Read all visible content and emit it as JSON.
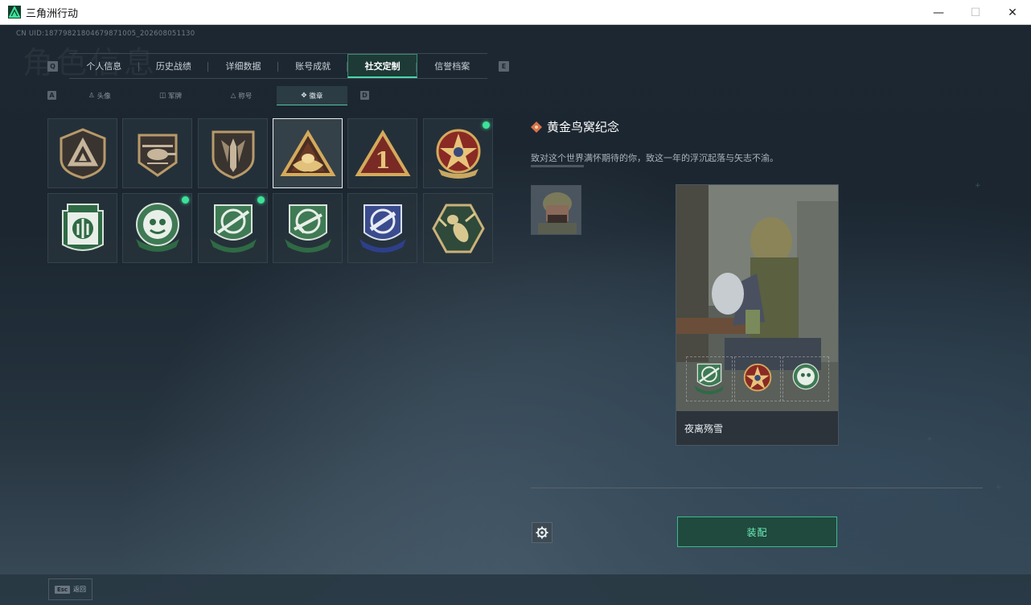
{
  "window": {
    "title": "三角洲行动",
    "minimize_glyph": "—",
    "maximize_glyph": "☐",
    "close_glyph": "✕"
  },
  "header": {
    "uid": "CN UID:18779821804679871005_202608051130",
    "bg_title": "角色信息"
  },
  "tabs": {
    "prev_key": "Q",
    "next_key": "E",
    "items": [
      {
        "label": "个人信息",
        "active": false
      },
      {
        "label": "历史战绩",
        "active": false
      },
      {
        "label": "详细数据",
        "active": false
      },
      {
        "label": "账号成就",
        "active": false
      },
      {
        "label": "社交定制",
        "active": true
      },
      {
        "label": "信誉档案",
        "active": false
      }
    ]
  },
  "subtabs": {
    "prev_key": "A",
    "next_key": "D",
    "items": [
      {
        "label": "头像",
        "icon": "person-icon",
        "glyph": "♙",
        "active": false
      },
      {
        "label": "军牌",
        "icon": "dogtag-icon",
        "glyph": "◫",
        "active": false
      },
      {
        "label": "称号",
        "icon": "triangle-icon",
        "glyph": "△",
        "active": false
      },
      {
        "label": "徽章",
        "icon": "badge-icon",
        "glyph": "✥",
        "active": true
      }
    ]
  },
  "badges": [
    {
      "icon": "delta-shield-badge-icon",
      "new": false,
      "selected": false
    },
    {
      "icon": "helicopter-badge-icon",
      "new": false,
      "selected": false
    },
    {
      "icon": "dagger-shield-badge-icon",
      "new": false,
      "selected": false
    },
    {
      "icon": "golden-nest-badge-icon",
      "new": false,
      "selected": true
    },
    {
      "icon": "number-one-badge-icon",
      "new": false,
      "selected": false
    },
    {
      "icon": "star-medal-badge-icon",
      "new": true,
      "selected": false
    },
    {
      "icon": "green-emblem-badge-icon",
      "new": false,
      "selected": false
    },
    {
      "icon": "green-beast-badge-icon",
      "new": true,
      "selected": false
    },
    {
      "icon": "green-crosshair-badge-icon",
      "new": true,
      "selected": false
    },
    {
      "icon": "green-rifle-badge-icon",
      "new": false,
      "selected": false
    },
    {
      "icon": "blue-knife-badge-icon",
      "new": false,
      "selected": false
    },
    {
      "icon": "wasp-hexagon-badge-icon",
      "new": false,
      "selected": false
    }
  ],
  "detail": {
    "title": "黄金鸟窝纪念",
    "description": "致对这个世界满怀期待的你，致这一年的浮沉起落与矢志不渝。",
    "card_name": "夜离殇雪",
    "equip_label": "装配"
  },
  "footer": {
    "esc_key": "Esc",
    "esc_label": "返回"
  },
  "colors": {
    "accent": "#4ed6a8",
    "new_dot": "#3de29a",
    "equip_bg": "#1f4a3d"
  }
}
